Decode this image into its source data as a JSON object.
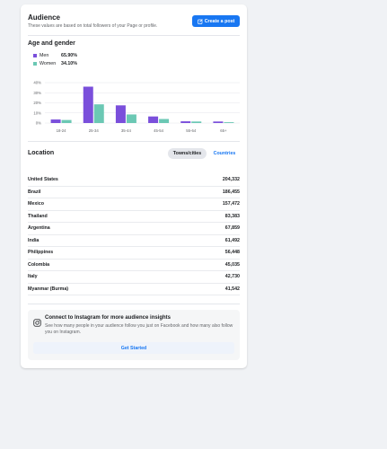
{
  "header": {
    "title": "Audience",
    "subtitle": "These values are based on total followers of your Page or profile.",
    "create_post_label": "Create a post",
    "create_post_icon": "edit-square-icon"
  },
  "age_gender": {
    "title": "Age and gender",
    "legend": [
      {
        "name": "Men",
        "value": "65.90%",
        "color": "#7a4fdb"
      },
      {
        "name": "Women",
        "value": "34.10%",
        "color": "#6bc8b4"
      }
    ]
  },
  "chart_data": {
    "type": "bar",
    "categories": [
      "18-24",
      "25-34",
      "35-44",
      "45-54",
      "55-64",
      "65+"
    ],
    "series": [
      {
        "name": "Men",
        "values": [
          3.5,
          36,
          17.5,
          6.5,
          1.7,
          1.5
        ],
        "color": "#7a4fdb"
      },
      {
        "name": "Women",
        "values": [
          3,
          18.5,
          8.5,
          4,
          1.5,
          0.8
        ],
        "color": "#6bc8b4"
      }
    ],
    "y_ticks": [
      "40%",
      "30%",
      "20%",
      "10%",
      "0%"
    ],
    "ylim": [
      0,
      40
    ],
    "grid": true,
    "title": "",
    "xlabel": "",
    "ylabel": ""
  },
  "location": {
    "title": "Location",
    "tabs": [
      {
        "label": "Towns/cities",
        "active": true
      },
      {
        "label": "Countries",
        "active": false
      }
    ],
    "rows": [
      {
        "name": "United States",
        "value": "204,332"
      },
      {
        "name": "Brazil",
        "value": "186,455"
      },
      {
        "name": "Mexico",
        "value": "157,472"
      },
      {
        "name": "Thailand",
        "value": "83,383"
      },
      {
        "name": "Argentina",
        "value": "67,859"
      },
      {
        "name": "India",
        "value": "61,492"
      },
      {
        "name": "Philippines",
        "value": "56,448"
      },
      {
        "name": "Colombia",
        "value": "45,035"
      },
      {
        "name": "Italy",
        "value": "42,730"
      },
      {
        "name": "Myanmar (Burma)",
        "value": "41,542"
      }
    ]
  },
  "instagram": {
    "title": "Connect to Instagram for more audience insights",
    "description": "See how many people in your audience follow you just on Facebook and how many also follow you on Instagram.",
    "button_label": "Get Started",
    "icon": "instagram-icon"
  }
}
